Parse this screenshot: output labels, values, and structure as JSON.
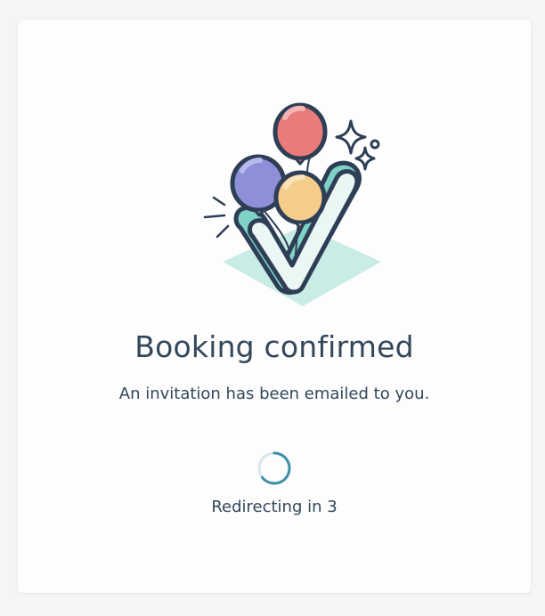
{
  "confirmation": {
    "title": "Booking confirmed",
    "message": "An invitation has been emailed to you.",
    "redirect_text": "Redirecting in 3"
  },
  "illustration": {
    "name": "balloons-checkmark-illustration",
    "colors": {
      "outline": "#2e3e55",
      "teal": "#7fd2c6",
      "teal_light": "#c9ece6",
      "check_fill": "#eaf7f5",
      "balloon_red": "#ea7b7b",
      "balloon_purple": "#8e8fd8",
      "balloon_yellow": "#f5cd8b"
    }
  },
  "spinner": {
    "color": "#3d90a8",
    "track_color": "#d7e7ec"
  }
}
